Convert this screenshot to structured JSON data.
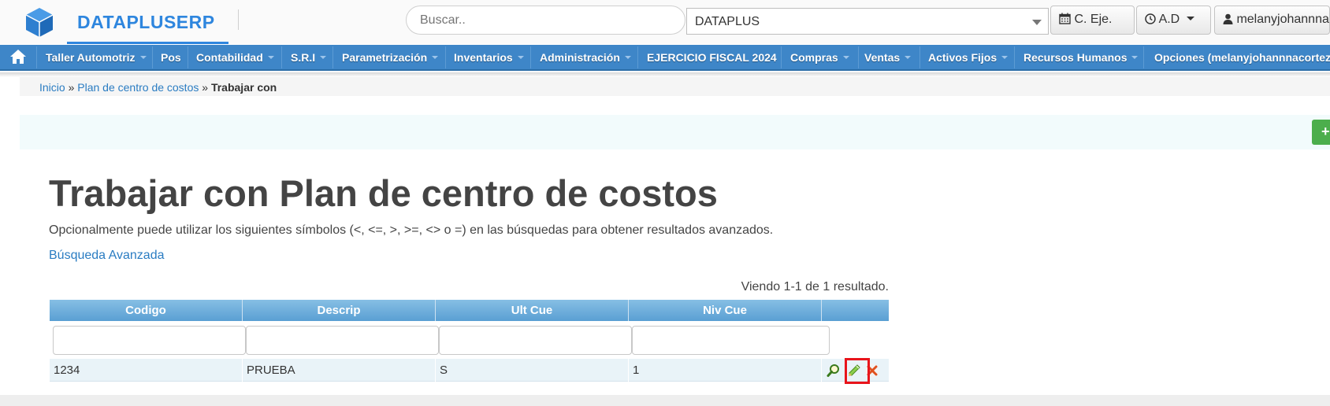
{
  "header": {
    "brand": "DATAPLUSERP",
    "search_placeholder": "Buscar..",
    "company_selected": "DATAPLUS",
    "fiscal_button": "C. Eje.",
    "ad_button": "A.D",
    "user_button": "melanyjohannnacortez"
  },
  "nav": {
    "items": [
      {
        "label": "Taller Automotriz",
        "dropdown": true
      },
      {
        "label": "Pos",
        "dropdown": false
      },
      {
        "label": "Contabilidad",
        "dropdown": true
      },
      {
        "label": "S.R.I",
        "dropdown": true
      },
      {
        "label": "Parametrización",
        "dropdown": true
      },
      {
        "label": "Inventarios",
        "dropdown": true
      },
      {
        "label": "Administración",
        "dropdown": true
      },
      {
        "label": "EJERCICIO FISCAL 2024",
        "dropdown": false
      },
      {
        "label": "Compras",
        "dropdown": true
      },
      {
        "label": "Ventas",
        "dropdown": true
      },
      {
        "label": "Activos Fijos",
        "dropdown": true
      },
      {
        "label": "Recursos Humanos",
        "dropdown": true
      },
      {
        "label": "Opciones (melanyjohannnacortez)",
        "dropdown": false
      }
    ]
  },
  "breadcrumb": {
    "home": "Inicio",
    "sep1": "»",
    "parent": "Plan de centro de costos",
    "sep2": "»",
    "current": "Trabajar con"
  },
  "page": {
    "title": "Trabajar con Plan de centro de costos",
    "hint": "Opcionalmente puede utilizar los siguientes símbolos (<, <=, >, >=, <> o =) en las búsquedas para obtener resultados avanzados.",
    "advanced_search": "Búsqueda Avanzada",
    "summary": "Viendo 1-1 de 1 resultado.",
    "add_glyph": "+"
  },
  "table": {
    "columns": [
      "Codigo",
      "Descrip",
      "Ult Cue",
      "Niv Cue"
    ],
    "rows": [
      {
        "codigo": "1234",
        "descrip": "PRUEBA",
        "ult_cue": "S",
        "niv_cue": "1"
      }
    ]
  },
  "colors": {
    "brand": "#2e86de",
    "navbar": "#3e86c8",
    "table_header": "#5a9fd3",
    "highlight": "#e8141b",
    "add_button": "#4cae4c"
  },
  "icons": {
    "logo": "cube-icon",
    "home": "home-icon",
    "calendar": "calendar-icon",
    "clock": "clock-icon",
    "user": "user-icon",
    "view": "magnifier-icon",
    "edit": "pencil-icon",
    "delete": "delete-x-icon"
  }
}
